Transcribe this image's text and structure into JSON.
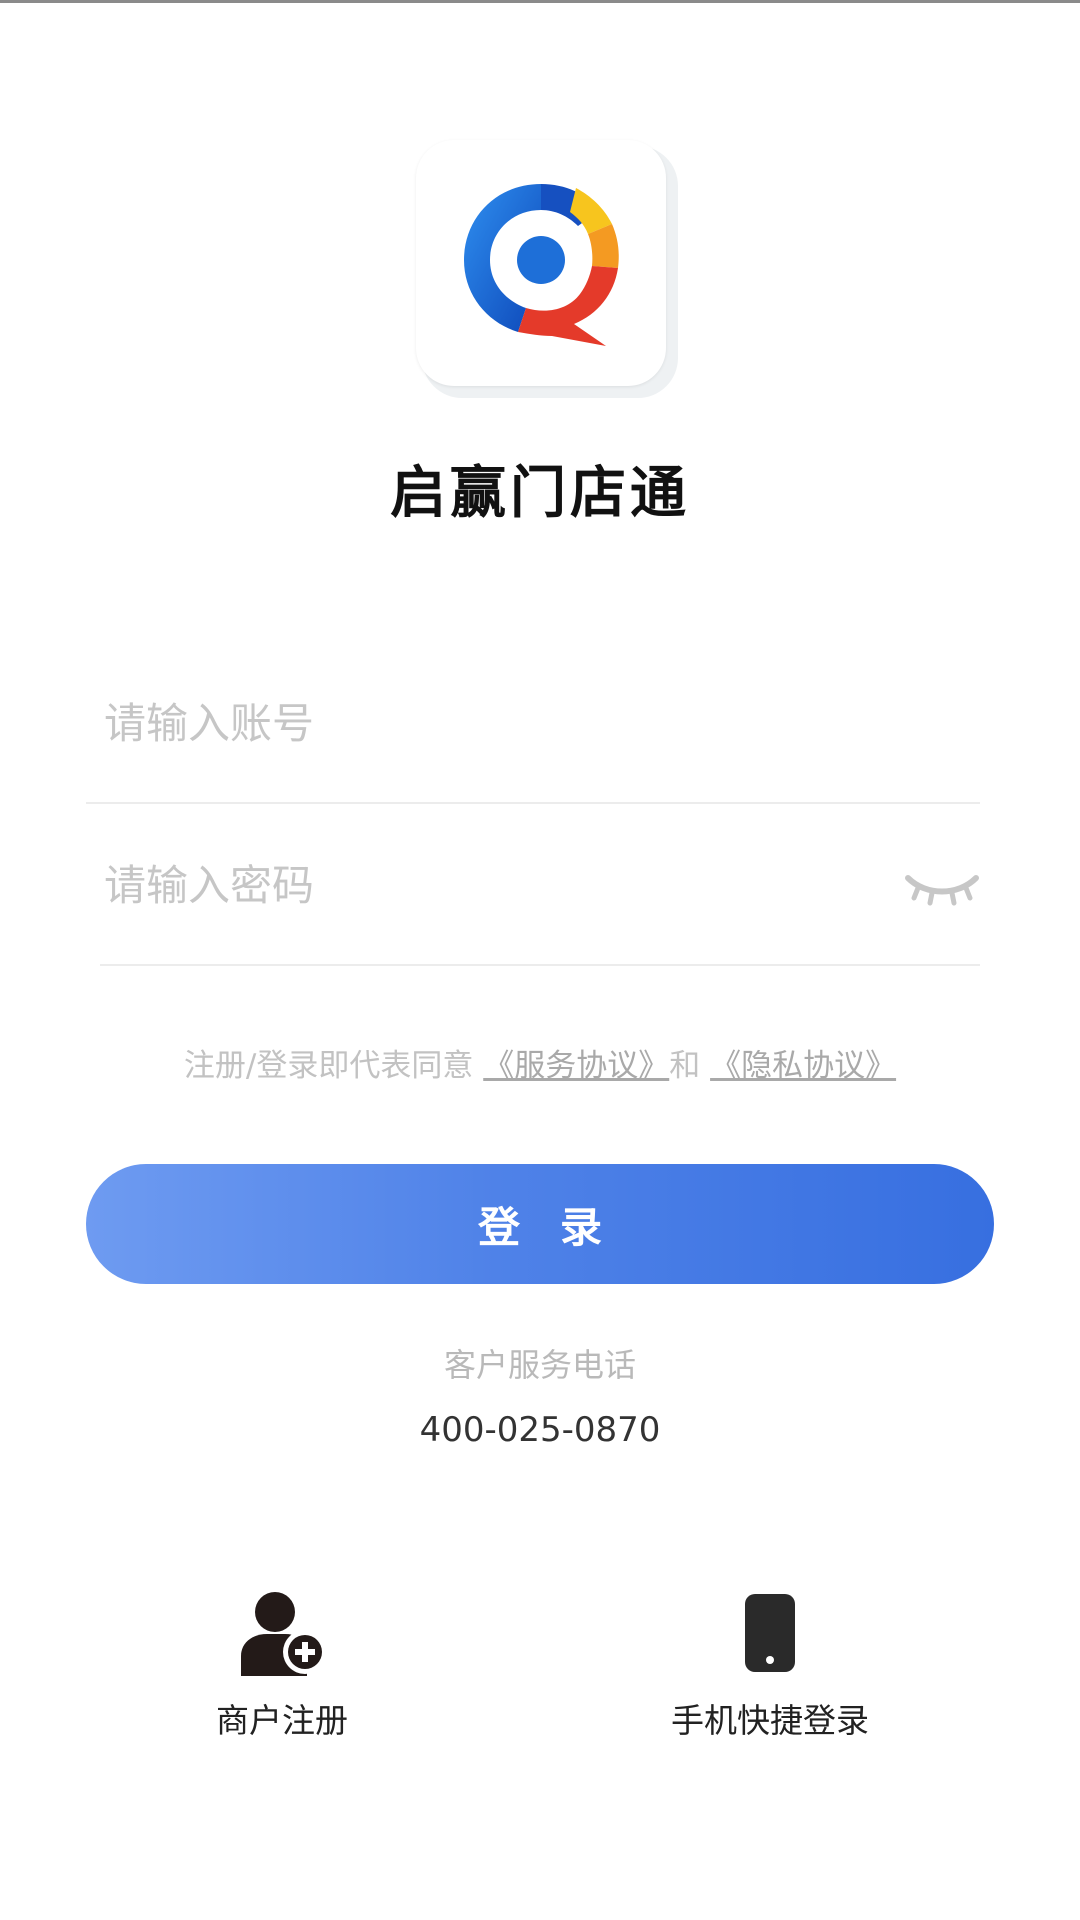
{
  "app": {
    "name": "启赢门店通",
    "logo_icon": "app-logo-icon"
  },
  "login_form": {
    "account_placeholder": "请输入账号",
    "password_placeholder": "请输入密码",
    "password_toggle_icon": "eye-closed-icon",
    "agreement_prefix": "注册/登录即代表同意",
    "service_agreement": "《服务协议》",
    "agreement_and": "和",
    "privacy_agreement": "《隐私协议》",
    "login_label": "登录"
  },
  "support": {
    "label": "客户服务电话",
    "phone": "400-025-0870"
  },
  "bottom_actions": [
    {
      "icon": "user-add-icon",
      "label": "商户注册"
    },
    {
      "icon": "mobile-phone-icon",
      "label": "手机快捷登录"
    }
  ],
  "colors": {
    "primary_start": "#6e9bf1",
    "primary_end": "#376fe0",
    "placeholder": "#c6c6c6"
  }
}
